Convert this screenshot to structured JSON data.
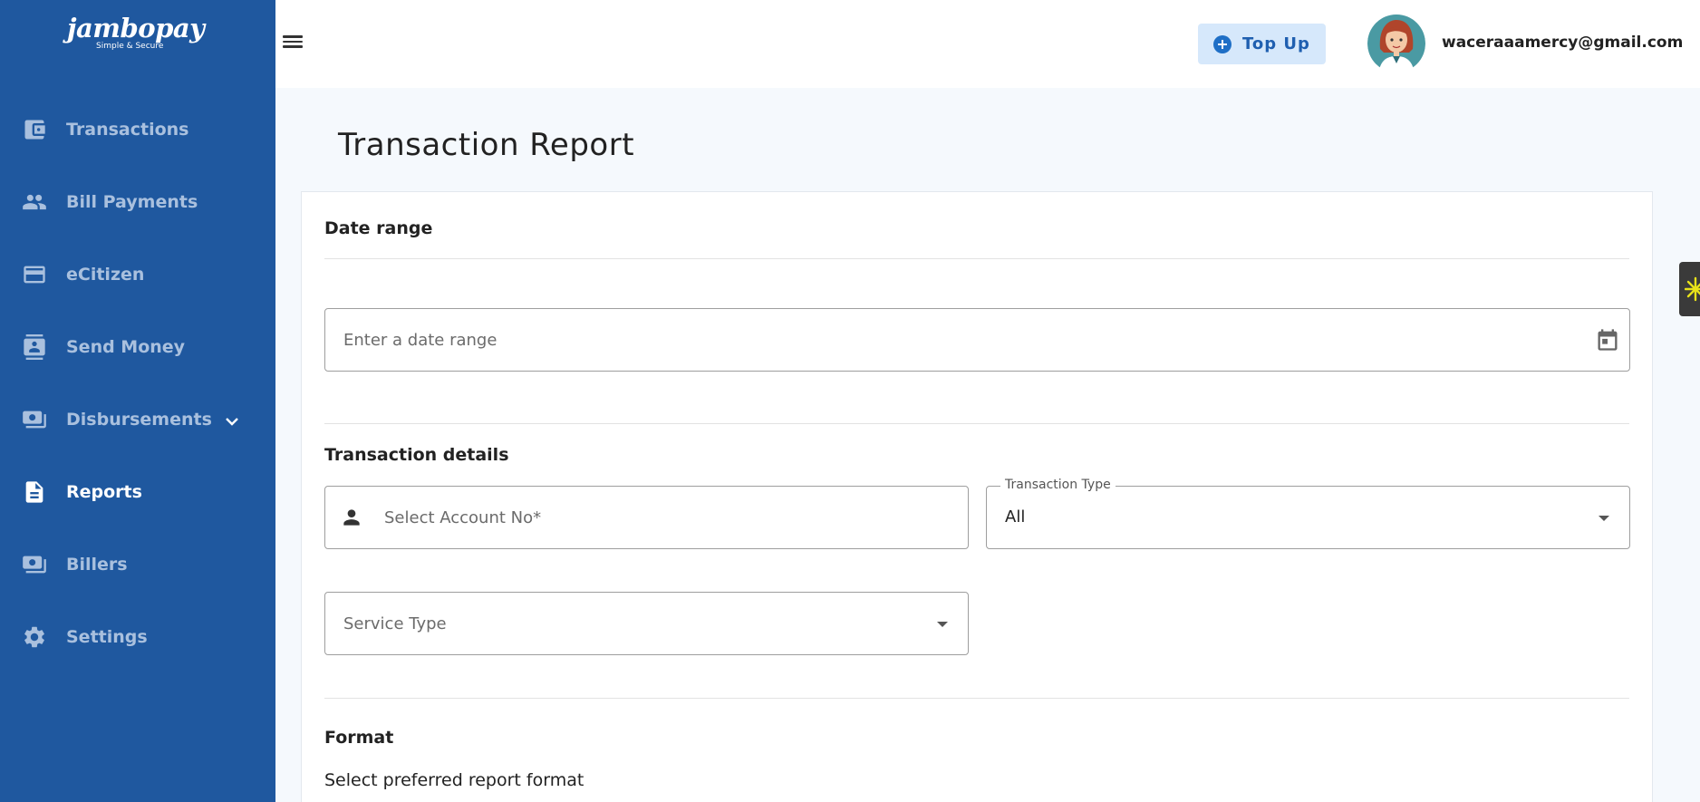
{
  "brand": {
    "name": "jambopay",
    "tagline": "Simple & Secure"
  },
  "sidebar": {
    "items": [
      {
        "label": "Transactions",
        "icon": "wallet-icon",
        "active": false
      },
      {
        "label": "Bill Payments",
        "icon": "people-icon",
        "active": false
      },
      {
        "label": "eCitizen",
        "icon": "credit-card-icon",
        "active": false
      },
      {
        "label": "Send Money",
        "icon": "contact-book-icon",
        "active": false
      },
      {
        "label": "Disbursements",
        "icon": "cash-icon",
        "active": false,
        "expandable": true
      },
      {
        "label": "Reports",
        "icon": "document-icon",
        "active": true
      },
      {
        "label": "Billers",
        "icon": "cash-icon",
        "active": false
      },
      {
        "label": "Settings",
        "icon": "gear-icon",
        "active": false
      }
    ]
  },
  "header": {
    "topup_label": "Top Up",
    "user_email": "waceraaamercy@gmail.com"
  },
  "main": {
    "title": "Transaction Report",
    "date_range": {
      "section_title": "Date range",
      "placeholder": "Enter a date range"
    },
    "transaction_details": {
      "section_title": "Transaction details",
      "account_placeholder": "Select Account No*",
      "transaction_type_label": "Transaction Type",
      "transaction_type_value": "All",
      "service_type_placeholder": "Service Type"
    },
    "format": {
      "section_title": "Format",
      "description": "Select preferred report format"
    }
  },
  "colors": {
    "sidebar_bg": "#1f589f",
    "sidebar_inactive_text": "#a9c0de",
    "topup_bg": "#d6e8fb",
    "topup_text": "#1f5fb0",
    "page_bg": "#f5f9fd"
  }
}
